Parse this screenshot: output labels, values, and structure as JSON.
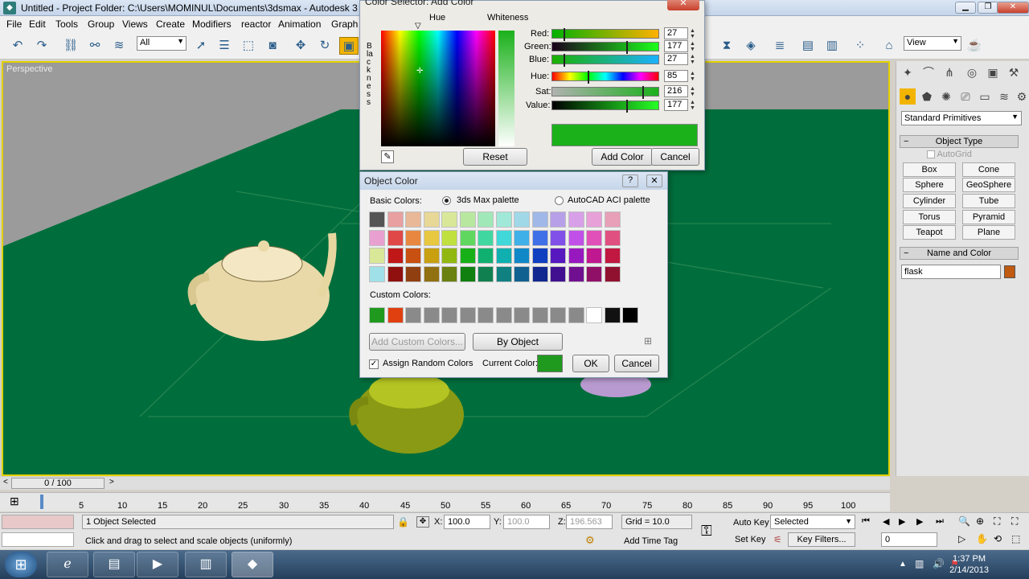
{
  "window": {
    "title": "Untitled     - Project Folder: C:\\Users\\MOMINUL\\Documents\\3dsmax     - Autodesk 3"
  },
  "menu": [
    "File",
    "Edit",
    "Tools",
    "Group",
    "Views",
    "Create",
    "Modifiers",
    "reactor",
    "Animation",
    "Graph"
  ],
  "toolbar": {
    "selection_filter": "All",
    "view_dropdown": "View"
  },
  "viewport": {
    "label": "Perspective"
  },
  "command_panel": {
    "category": "Standard Primitives",
    "object_type_title": "Object Type",
    "autogrid": "AutoGrid",
    "buttons": [
      "Box",
      "Cone",
      "Sphere",
      "GeoSphere",
      "Cylinder",
      "Tube",
      "Torus",
      "Pyramid",
      "Teapot",
      "Plane"
    ],
    "name_color_title": "Name and Color",
    "object_name": "flask",
    "object_color": "#c05a10"
  },
  "timeline": {
    "slider": "0 / 100",
    "ticks": [
      "5",
      "10",
      "15",
      "20",
      "25",
      "30",
      "35",
      "40",
      "45",
      "50",
      "55",
      "60",
      "65",
      "70",
      "75",
      "80",
      "85",
      "90",
      "95",
      "100"
    ]
  },
  "status": {
    "selection": "1 Object Selected",
    "prompt": "Click and drag to select and scale objects (uniformly)",
    "x_label": "X:",
    "x_value": "100.0",
    "y_label": "Y:",
    "y_value": "100.0",
    "z_label": "Z:",
    "z_value": "196.563",
    "grid": "Grid = 10.0",
    "add_time_tag": "Add Time Tag",
    "auto_key": "Auto Key",
    "set_key": "Set Key",
    "key_mode": "Selected",
    "key_filters": "Key Filters...",
    "frame": "0"
  },
  "taskbar": {
    "time": "1:37 PM",
    "date": "2/14/2013"
  },
  "color_selector": {
    "title": "Color Selector: Add Color",
    "hue_label": "Hue",
    "whiteness_label": "Whiteness",
    "blackness_label": "Blackness",
    "red_label": "Red:",
    "red_value": "27",
    "green_label": "Green:",
    "green_value": "177",
    "blue_label": "Blue:",
    "blue_value": "27",
    "hue_s_label": "Hue:",
    "hue_value": "85",
    "sat_label": "Sat:",
    "sat_value": "216",
    "value_label": "Value:",
    "value_value": "177",
    "preview_color": "#1bb11b",
    "reset": "Reset",
    "add_color": "Add Color",
    "cancel": "Cancel"
  },
  "object_color": {
    "title": "Object Color",
    "basic_colors_label": "Basic Colors:",
    "palette_3dsmax": "3ds Max palette",
    "palette_autocad": "AutoCAD ACI palette",
    "custom_colors_label": "Custom Colors:",
    "add_custom": "Add Custom Colors...",
    "by_object": "By Object",
    "assign_random": "Assign Random Colors",
    "current_color_label": "Current Color:",
    "current_color": "#1f9a1f",
    "ok": "OK",
    "cancel": "Cancel",
    "basic_rows": [
      [
        "#555555",
        "#e8a0a0",
        "#e8b898",
        "#e8d898",
        "#d8e898",
        "#b8e8a0",
        "#a0e8b8",
        "#a0e8d8",
        "#a0d8e8",
        "#a0b8e8",
        "#b8a0e8",
        "#d8a0e8",
        "#e8a0d8",
        "#e8a0b8"
      ],
      [
        "#e8a0d0",
        "#e04848",
        "#e88840",
        "#e8c840",
        "#c0e040",
        "#60d860",
        "#40d8a0",
        "#40d8d8",
        "#40b0e8",
        "#4070e8",
        "#8050e8",
        "#c050e8",
        "#e050b8",
        "#e05080"
      ],
      [
        "#d8e898",
        "#c01818",
        "#c85010",
        "#c8a010",
        "#90b810",
        "#18b018",
        "#10b070",
        "#10b0b0",
        "#1088c8",
        "#1040c0",
        "#5818c0",
        "#9818c0",
        "#c01890",
        "#c01840"
      ],
      [
        "#a0e0e8",
        "#901010",
        "#904010",
        "#907010",
        "#6a8010",
        "#108010",
        "#108050",
        "#108080",
        "#106090",
        "#102890",
        "#401090",
        "#701090",
        "#901068",
        "#901030"
      ]
    ],
    "custom_swatches": [
      "#1f9a1f",
      "#e04010",
      "#8a8a8a",
      "#8a8a8a",
      "#8a8a8a",
      "#8a8a8a",
      "#8a8a8a",
      "#8a8a8a",
      "#8a8a8a",
      "#8a8a8a",
      "#8a8a8a",
      "#8a8a8a",
      "#ffffff",
      "#111111",
      "#000000"
    ]
  }
}
